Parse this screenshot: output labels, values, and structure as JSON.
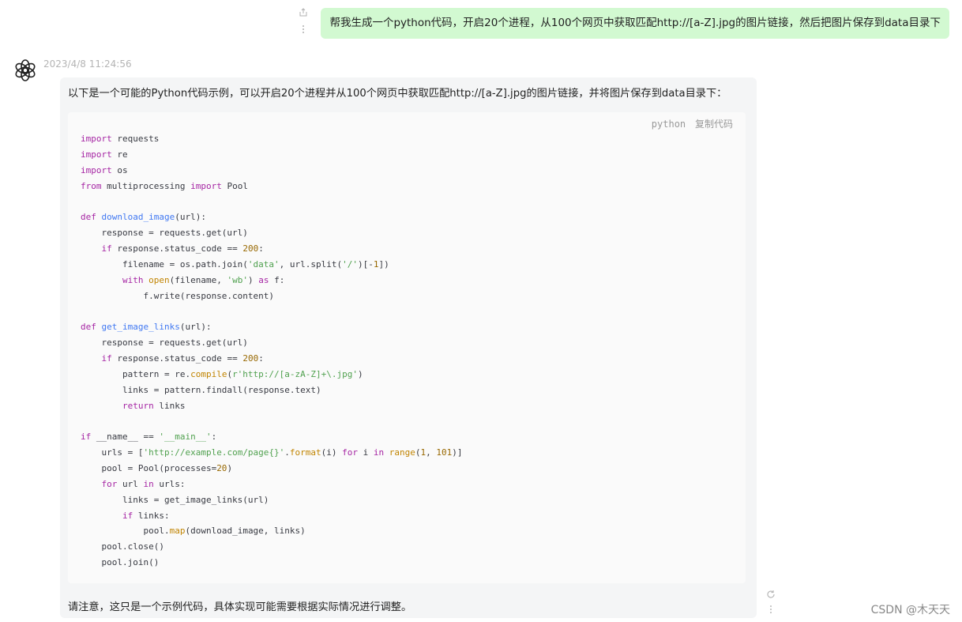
{
  "user_message": {
    "text": "帮我生成一个python代码，开启20个进程，从100个网页中获取匹配http://[a-Z].jpg的图片链接，然后把图片保存到data目录下",
    "actions": {
      "share_icon": "share-icon",
      "more_icon": "more-vertical-icon"
    }
  },
  "bot_message": {
    "timestamp": "2023/4/8 11:24:56",
    "avatar_icon": "openai-logo-icon",
    "intro": "以下是一个可能的Python代码示例，可以开启20个进程并从100个网页中获取匹配http://[a-Z].jpg的图片链接，并将图片保存到data目录下：",
    "code_block": {
      "language": "python",
      "copy_label": "复制代码",
      "lines": [
        "import requests",
        "import re",
        "import os",
        "from multiprocessing import Pool",
        "",
        "def download_image(url):",
        "    response = requests.get(url)",
        "    if response.status_code == 200:",
        "        filename = os.path.join('data', url.split('/')[-1])",
        "        with open(filename, 'wb') as f:",
        "            f.write(response.content)",
        "",
        "def get_image_links(url):",
        "    response = requests.get(url)",
        "    if response.status_code == 200:",
        "        pattern = re.compile(r'http://[a-zA-Z]+\\.jpg')",
        "        links = pattern.findall(response.text)",
        "        return links",
        "",
        "if __name__ == '__main__':",
        "    urls = ['http://example.com/page{}'.format(i) for i in range(1, 101)]",
        "    pool = Pool(processes=20)",
        "    for url in urls:",
        "        links = get_image_links(url)",
        "        if links:",
        "            pool.map(download_image, links)",
        "    pool.close()",
        "    pool.join()"
      ]
    },
    "outro": "请注意，这只是一个示例代码，具体实现可能需要根据实际情况进行调整。",
    "actions": {
      "reload_icon": "reload-icon",
      "more_icon": "more-vertical-icon"
    }
  },
  "credit": "CSDN @木天天",
  "colors": {
    "user_bubble": "#d2f9d1",
    "bot_card": "#f4f5f6",
    "code_bg": "#fafafa",
    "keyword": "#a626a4",
    "function": "#4078f2",
    "builtin": "#c18401",
    "string": "#50a14f",
    "number": "#986801"
  }
}
